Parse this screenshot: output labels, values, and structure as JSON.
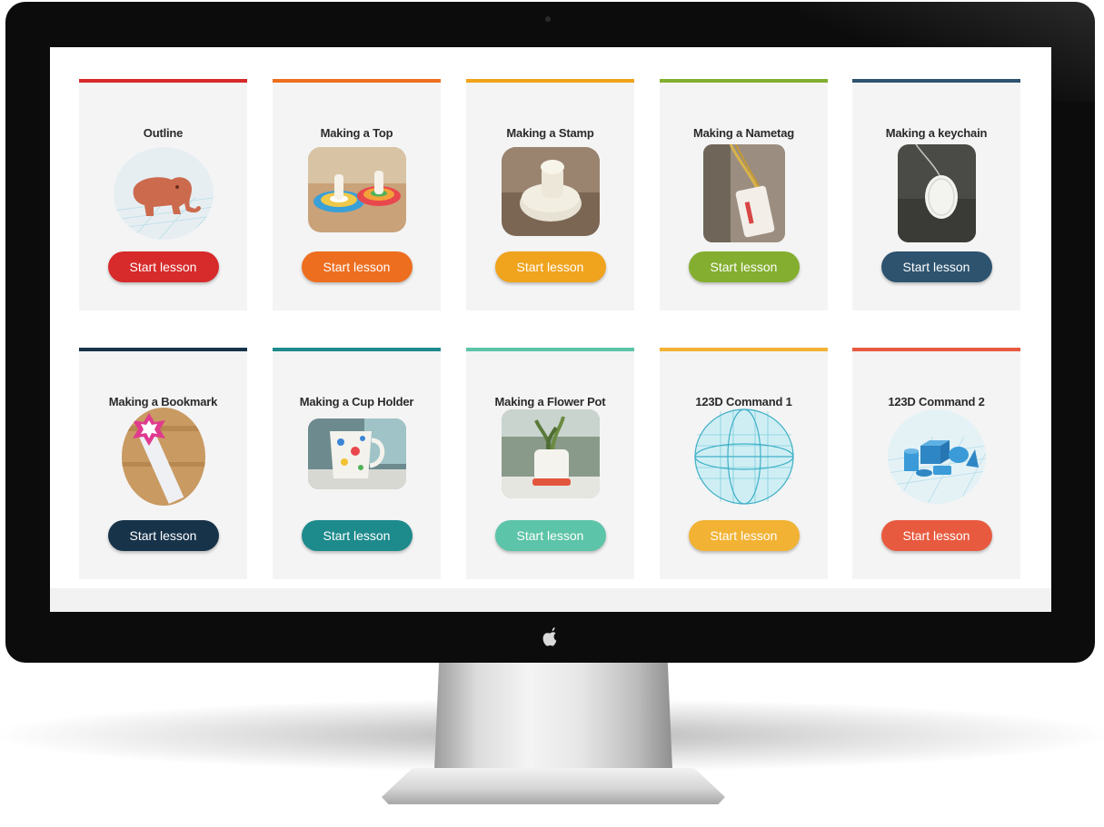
{
  "colors": {
    "red": "#d72a2a",
    "orange": "#ee6e1f",
    "amber": "#f0a31c",
    "green": "#83ae2f",
    "steel": "#2d536f",
    "navy": "#17334a",
    "teal": "#1d8a8c",
    "mint": "#5cc4a8",
    "yellow": "#f2b233",
    "coral": "#e85a3f"
  },
  "lessons": [
    {
      "title": "Outline",
      "button": "Start lesson",
      "color": "#d72a2a",
      "image": "elephant-model-icon"
    },
    {
      "title": "Making a Top",
      "button": "Start lesson",
      "color": "#ee6e1f",
      "image": "spinning-top-photo"
    },
    {
      "title": "Making a Stamp",
      "button": "Start lesson",
      "color": "#f0a31c",
      "image": "stamp-photo"
    },
    {
      "title": "Making a Nametag",
      "button": "Start lesson",
      "color": "#83ae2f",
      "image": "nametag-photo"
    },
    {
      "title": "Making a keychain",
      "button": "Start lesson",
      "color": "#2d536f",
      "image": "keychain-photo"
    },
    {
      "title": "Making a Bookmark",
      "button": "Start lesson",
      "color": "#17334a",
      "image": "bookmark-photo"
    },
    {
      "title": "Making a Cup Holder",
      "button": "Start lesson",
      "color": "#1d8a8c",
      "image": "cup-holder-photo"
    },
    {
      "title": "Making a Flower Pot",
      "button": "Start lesson",
      "color": "#5cc4a8",
      "image": "flower-pot-photo"
    },
    {
      "title": "123D Command 1",
      "button": "Start lesson",
      "color": "#f2b233",
      "image": "sphere-wireframe-icon"
    },
    {
      "title": "123D Command 2",
      "button": "Start lesson",
      "color": "#e85a3f",
      "image": "primitive-shapes-icon"
    }
  ]
}
